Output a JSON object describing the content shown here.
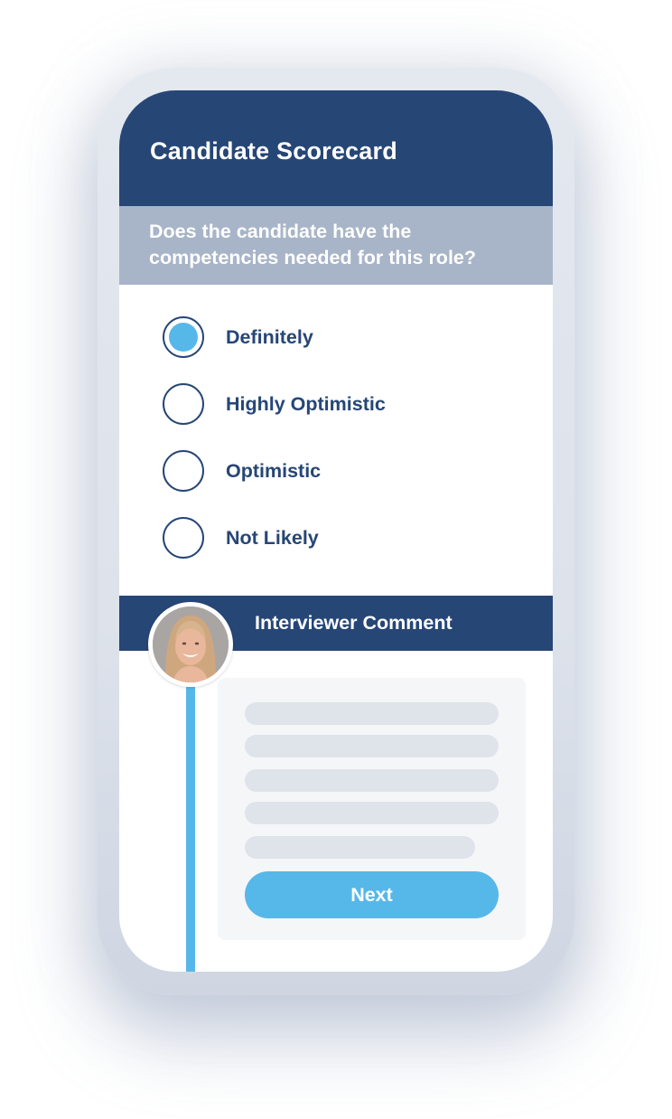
{
  "header": {
    "title": "Candidate Scorecard"
  },
  "question": {
    "text": "Does the candidate have the competencies needed for this role?"
  },
  "options": [
    {
      "label": "Definitely",
      "selected": true
    },
    {
      "label": "Highly Optimistic",
      "selected": false
    },
    {
      "label": "Optimistic",
      "selected": false
    },
    {
      "label": "Not Likely",
      "selected": false
    }
  ],
  "comment": {
    "title": "Interviewer Comment",
    "avatar": "interviewer-photo",
    "placeholder_lines": 5,
    "next_label": "Next"
  },
  "colors": {
    "primary": "#264676",
    "accent": "#56b8e8",
    "question_bg": "#a8b4c7",
    "placeholder": "#dfe3ea"
  }
}
